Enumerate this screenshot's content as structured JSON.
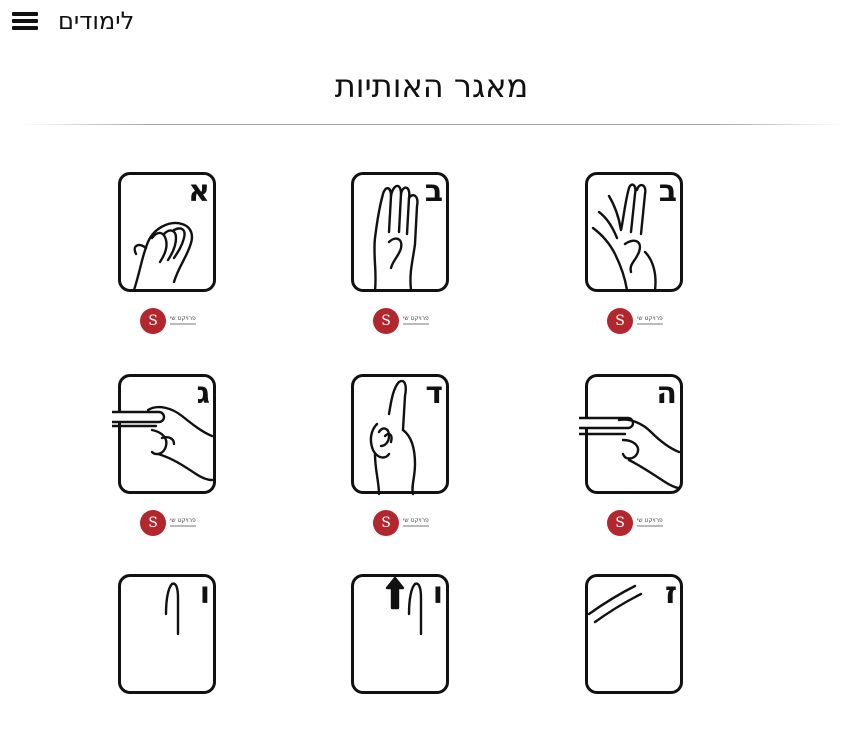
{
  "header": {
    "menu_label": "לימודים",
    "menu_icon": "hamburger-icon"
  },
  "page": {
    "title": "מאגר האותיות"
  },
  "letters": [
    {
      "letter": "א",
      "logo_letter": "S",
      "logo_text": "פרויקט שי"
    },
    {
      "letter": "ב",
      "logo_letter": "S",
      "logo_text": "פרויקט שי"
    },
    {
      "letter": "ב",
      "logo_letter": "S",
      "logo_text": "פרויקט שי"
    },
    {
      "letter": "ג",
      "logo_letter": "S",
      "logo_text": "פרויקט שי"
    },
    {
      "letter": "ד",
      "logo_letter": "S",
      "logo_text": "פרויקט שי"
    },
    {
      "letter": "ה",
      "logo_letter": "S",
      "logo_text": "פרויקט שי"
    },
    {
      "letter": "ו",
      "logo_letter": "",
      "logo_text": ""
    },
    {
      "letter": "ו",
      "logo_letter": "",
      "logo_text": ""
    },
    {
      "letter": "ז",
      "logo_letter": "",
      "logo_text": ""
    }
  ],
  "colors": {
    "logo_red": "#b2272d",
    "ink": "#111111"
  }
}
